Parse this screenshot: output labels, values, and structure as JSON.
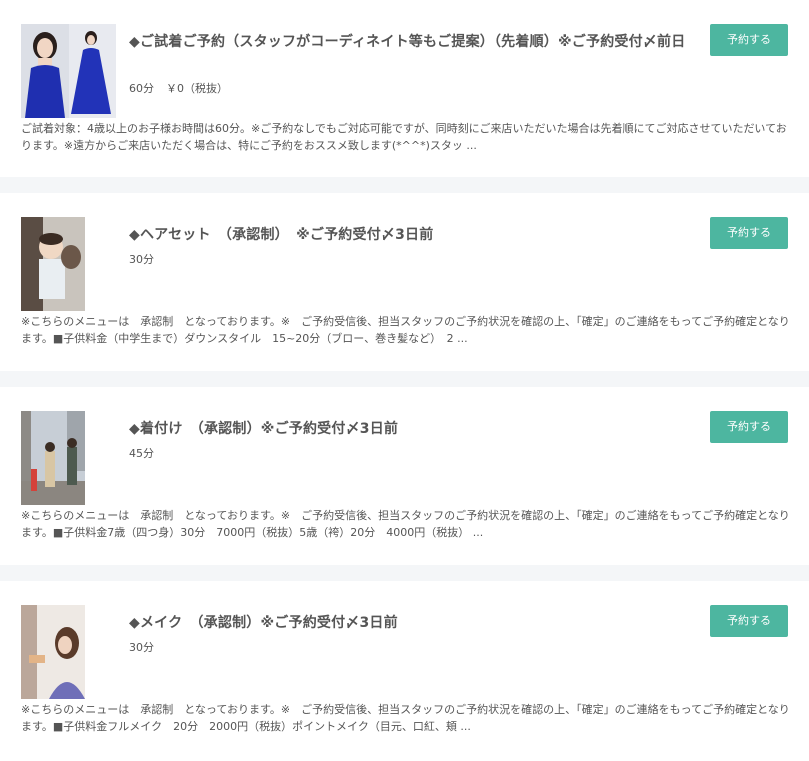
{
  "colors": {
    "accent": "#4db6a0",
    "background": "#f4f6f8",
    "card": "#ffffff",
    "text": "#555555"
  },
  "menus": [
    {
      "title": "◆ご試着ご予約（スタッフがコーディネイト等もご提案）（先着順）※ご予約受付〆前日",
      "duration": "60分",
      "price": "￥0（税抜）",
      "description": "ご試着対象：4歳以上のお子様お時間は60分。※ご予約なしでもご対応可能ですが、同時刻にご来店いただいた場合は先着順にてご対応させていただいております。※遠方からご来店いただく場合は、特にご予約をおススメ致します(*^^*)スタッ ...",
      "button": "予約する"
    },
    {
      "title": "◆ヘアセット　（承認制）　※ご予約受付〆3日前",
      "duration": "30分",
      "description": "※こちらのメニューは　承認制　となっております。※　ご予約受信後、担当スタッフのご予約状況を確認の上、「確定」のご連絡をもってご予約確定となります。■子供料金（中学生まで）ダウンスタイル　15~20分（ブロー、巻き髪など）　2 ...",
      "button": "予約する"
    },
    {
      "title": "◆着付け　（承認制）※ご予約受付〆3日前",
      "duration": "45分",
      "description": "※こちらのメニューは　承認制　となっております。※　ご予約受信後、担当スタッフのご予約状況を確認の上、「確定」のご連絡をもってご予約確定となります。■子供料金7歳（四つ身）30分　7000円（税抜）5歳（袴）20分　4000円（税抜） ...",
      "button": "予約する"
    },
    {
      "title": "◆メイク　（承認制）※ご予約受付〆3日前",
      "duration": "30分",
      "description": "※こちらのメニューは　承認制　となっております。※　ご予約受信後、担当スタッフのご予約状況を確認の上、「確定」のご連絡をもってご予約確定となります。■子供料金フルメイク　20分　2000円（税抜）ポイントメイク（目元、口紅、頬 ...",
      "button": "予約する"
    }
  ]
}
